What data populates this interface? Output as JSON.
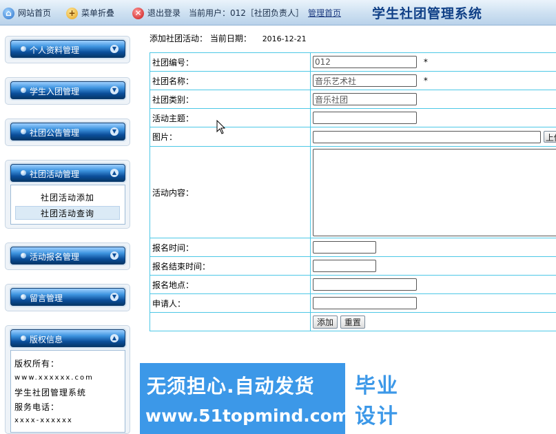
{
  "topbar": {
    "home_label": "网站首页",
    "fold_label": "菜单折叠",
    "logout_label": "退出登录",
    "current_user_label": "当前用户：012［社团负责人］",
    "admin_home_label": "管理首页",
    "app_title": "学生社团管理系统",
    "icons": [
      "home-icon",
      "fold-icon",
      "exit-icon"
    ]
  },
  "sidebar": {
    "menus": [
      {
        "label": "个人资料管理",
        "state": "collapsed"
      },
      {
        "label": "学生入团管理",
        "state": "collapsed"
      },
      {
        "label": "社团公告管理",
        "state": "collapsed"
      },
      {
        "label": "社团活动管理",
        "state": "expanded"
      },
      {
        "label": "活动报名管理",
        "state": "collapsed"
      },
      {
        "label": "留言管理",
        "state": "collapsed"
      },
      {
        "label": "版权信息",
        "state": "expanded"
      }
    ],
    "activity_sub": [
      "社团活动添加",
      "社团活动查询"
    ],
    "copyright": {
      "owner_label": "版权所有：",
      "site": "www.xxxxxx.com",
      "system_name": "学生社团管理系统",
      "phone_label": "服务电话：",
      "phone": "xxxx-xxxxxx"
    }
  },
  "form": {
    "header_label": "添加社团活动：",
    "date_label": "当前日期：",
    "date_value": "2016-12-21",
    "rows": {
      "club_id": {
        "label": "社团编号：",
        "value": "012",
        "required": "*"
      },
      "club_name": {
        "label": "社团名称：",
        "value": "音乐艺术社",
        "required": "*"
      },
      "club_type": {
        "label": "社团类别：",
        "value": "音乐社团"
      },
      "topic": {
        "label": "活动主题：",
        "value": ""
      },
      "image": {
        "label": "图片：",
        "value": "",
        "upload_label": "上传"
      },
      "content": {
        "label": "活动内容：",
        "value": ""
      },
      "signup_time": {
        "label": "报名时间：",
        "value": ""
      },
      "signup_end": {
        "label": "报名结束时间：",
        "value": ""
      },
      "signup_place": {
        "label": "报名地点：",
        "value": ""
      },
      "applicant": {
        "label": "申请人：",
        "value": ""
      }
    },
    "add_button": "添加",
    "reset_button": "重置"
  },
  "watermark": {
    "line1": "无须担心.自动发货",
    "line2": "www.51topmind.com",
    "logo_line1": "毕业",
    "logo_line2": "设计"
  },
  "colors": {
    "accent": "#0b4e9a",
    "table_border": "#4bc7e6",
    "watermark_bg": "#3c98e8"
  }
}
